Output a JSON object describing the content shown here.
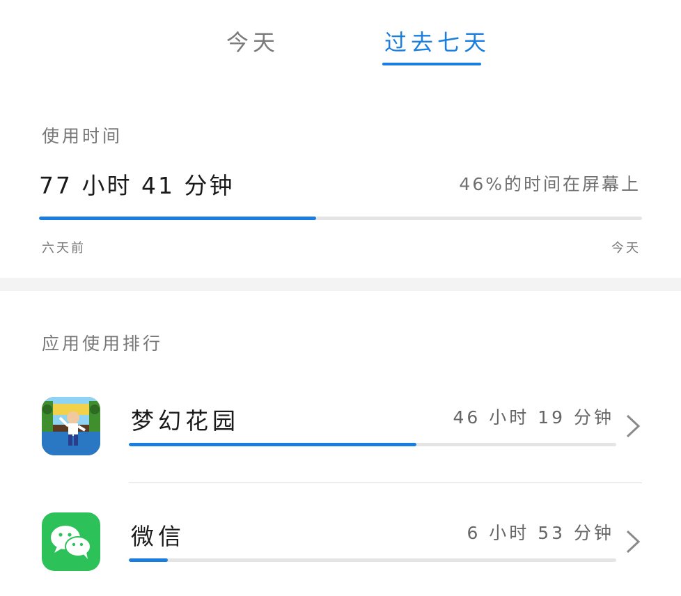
{
  "tabs": [
    {
      "label": "今天",
      "active": false
    },
    {
      "label": "过去七天",
      "active": true
    }
  ],
  "usage": {
    "section_label": "使用时间",
    "total": "77 小时 41 分钟",
    "screen_percent_text": "46%的时间在屏幕上",
    "progress": 0.46,
    "axis_start": "六天前",
    "axis_end": "今天"
  },
  "ranking": {
    "section_label": "应用使用排行",
    "apps": [
      {
        "name": "梦幻花园",
        "time": "46 小时 19 分钟",
        "progress": 0.59,
        "icon": "gardenscapes-app-icon"
      },
      {
        "name": "微信",
        "time": "6 小时 53 分钟",
        "progress": 0.08,
        "icon": "wechat-app-icon"
      }
    ]
  },
  "colors": {
    "accent": "#1a7ee0",
    "track": "#e5e5e5",
    "wechat_green": "#2dc15a"
  }
}
